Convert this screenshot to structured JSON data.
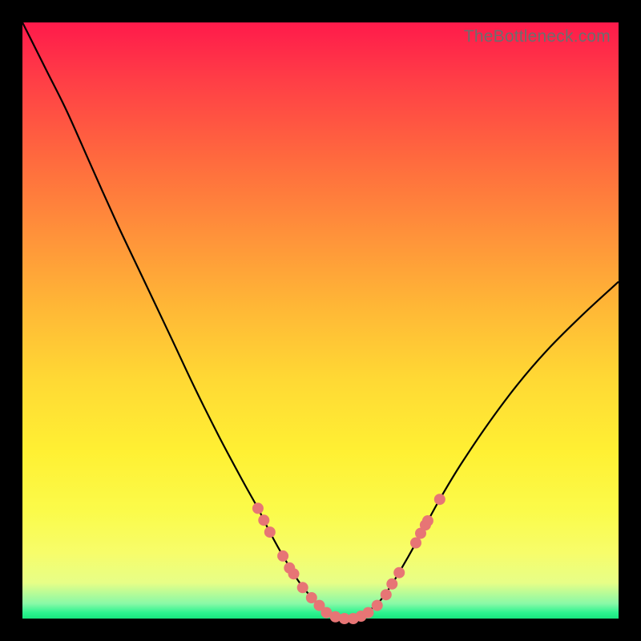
{
  "watermark": "TheBottleneck.com",
  "colors": {
    "top": "#ff1a4b",
    "mid": "#fff033",
    "bottom": "#18e57f",
    "marker": "#e77575",
    "curve": "#000000",
    "frame": "#000000"
  },
  "chart_data": {
    "type": "line",
    "title": "",
    "xlabel": "",
    "ylabel": "",
    "xlim": [
      0,
      1
    ],
    "ylim": [
      0,
      1
    ],
    "curve": [
      {
        "x": 0.0,
        "y": 1.0
      },
      {
        "x": 0.015,
        "y": 0.97
      },
      {
        "x": 0.04,
        "y": 0.92
      },
      {
        "x": 0.075,
        "y": 0.85
      },
      {
        "x": 0.115,
        "y": 0.76
      },
      {
        "x": 0.16,
        "y": 0.66
      },
      {
        "x": 0.205,
        "y": 0.565
      },
      {
        "x": 0.25,
        "y": 0.47
      },
      {
        "x": 0.29,
        "y": 0.385
      },
      {
        "x": 0.33,
        "y": 0.305
      },
      {
        "x": 0.37,
        "y": 0.23
      },
      {
        "x": 0.395,
        "y": 0.185
      },
      {
        "x": 0.415,
        "y": 0.145
      },
      {
        "x": 0.44,
        "y": 0.1
      },
      {
        "x": 0.465,
        "y": 0.06
      },
      {
        "x": 0.49,
        "y": 0.03
      },
      {
        "x": 0.51,
        "y": 0.012
      },
      {
        "x": 0.53,
        "y": 0.003
      },
      {
        "x": 0.55,
        "y": 0.0
      },
      {
        "x": 0.565,
        "y": 0.003
      },
      {
        "x": 0.58,
        "y": 0.012
      },
      {
        "x": 0.6,
        "y": 0.03
      },
      {
        "x": 0.62,
        "y": 0.058
      },
      {
        "x": 0.645,
        "y": 0.1
      },
      {
        "x": 0.67,
        "y": 0.145
      },
      {
        "x": 0.7,
        "y": 0.2
      },
      {
        "x": 0.735,
        "y": 0.258
      },
      {
        "x": 0.78,
        "y": 0.325
      },
      {
        "x": 0.83,
        "y": 0.392
      },
      {
        "x": 0.88,
        "y": 0.45
      },
      {
        "x": 0.94,
        "y": 0.51
      },
      {
        "x": 1.0,
        "y": 0.565
      }
    ],
    "markers": [
      {
        "x": 0.395,
        "y": 0.185
      },
      {
        "x": 0.405,
        "y": 0.165
      },
      {
        "x": 0.415,
        "y": 0.145
      },
      {
        "x": 0.437,
        "y": 0.105
      },
      {
        "x": 0.448,
        "y": 0.085
      },
      {
        "x": 0.455,
        "y": 0.075
      },
      {
        "x": 0.47,
        "y": 0.052
      },
      {
        "x": 0.485,
        "y": 0.035
      },
      {
        "x": 0.498,
        "y": 0.022
      },
      {
        "x": 0.51,
        "y": 0.01
      },
      {
        "x": 0.525,
        "y": 0.003
      },
      {
        "x": 0.54,
        "y": 0.0
      },
      {
        "x": 0.555,
        "y": 0.0
      },
      {
        "x": 0.568,
        "y": 0.004
      },
      {
        "x": 0.58,
        "y": 0.01
      },
      {
        "x": 0.595,
        "y": 0.022
      },
      {
        "x": 0.61,
        "y": 0.04
      },
      {
        "x": 0.62,
        "y": 0.058
      },
      {
        "x": 0.632,
        "y": 0.077
      },
      {
        "x": 0.66,
        "y": 0.127
      },
      {
        "x": 0.668,
        "y": 0.143
      },
      {
        "x": 0.676,
        "y": 0.157
      },
      {
        "x": 0.68,
        "y": 0.164
      },
      {
        "x": 0.7,
        "y": 0.2
      }
    ]
  }
}
